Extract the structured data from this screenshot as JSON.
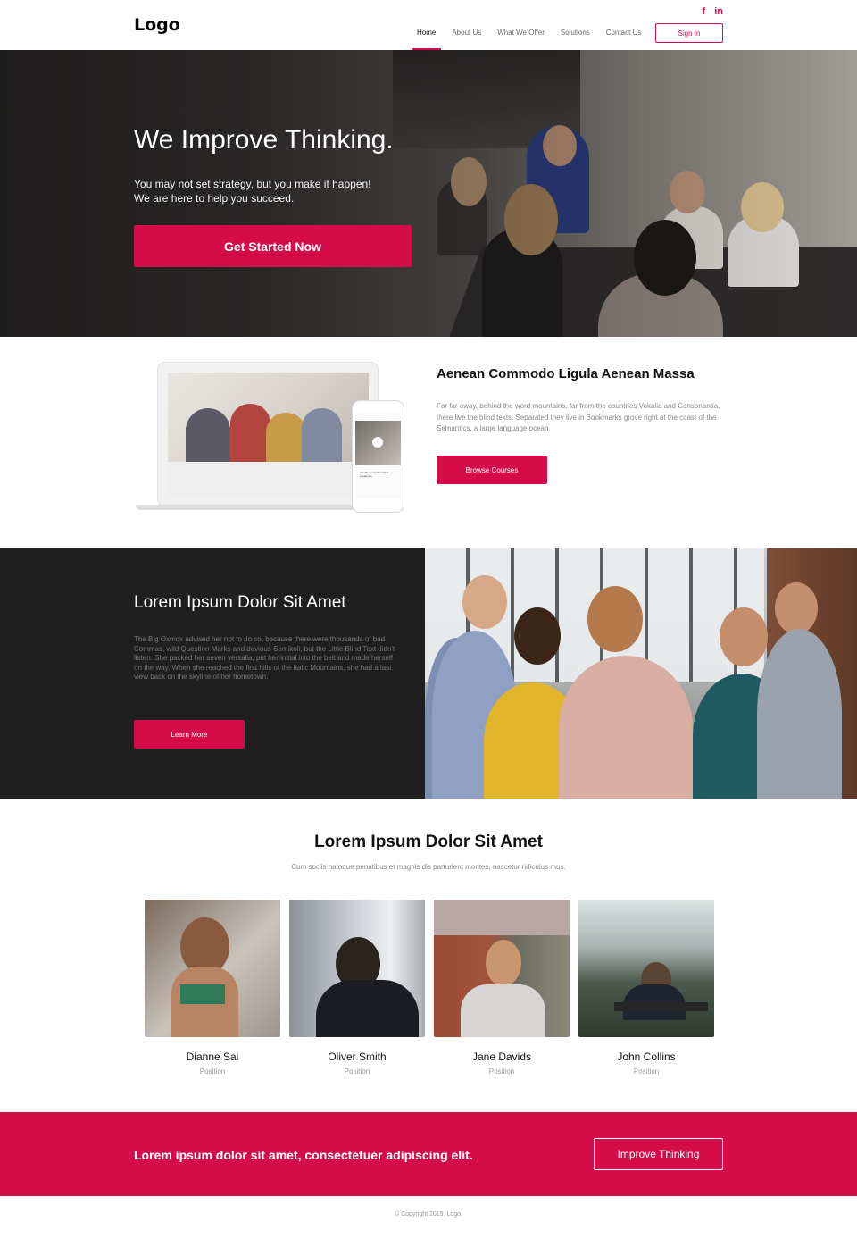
{
  "header": {
    "logo": "Logo",
    "social": {
      "facebook": "f",
      "linkedin": "in"
    },
    "nav": [
      "Home",
      "About Us",
      "What We Offer",
      "Solutions",
      "Contact Us"
    ],
    "active_nav": "Home",
    "signin": "Sign In"
  },
  "hero": {
    "title": "We Improve Thinking.",
    "subtitle_line1": "You may not set strategy, but you make it happen!",
    "subtitle_line2": "We are here to help you succeed.",
    "cta": "Get Started Now"
  },
  "about": {
    "title": "Aenean Commodo Ligula Aenean Massa",
    "text": "Far far away, behind the word mountains, far from the countries Vokalia and Consonantia, there live the blind texts. Separated they live in Bookmarks grove right at the coast of the Semantics, a large language ocean.",
    "button": "Browse Courses",
    "phone_caption": "Visualt mentosiba digital expelones"
  },
  "dark_section": {
    "title": "Lorem Ipsum Dolor Sit Amet",
    "text": "The Big Oxmox advised her not to do so, because there were thousands of bad Commas, wild Question Marks and devious Semikoli, but the Little Blind Text didn't listen. She packed her seven versalia, put her initial into the belt and made herself on the way. When she reached the first hills of the Italic Mountains, she had a last view back on the skyline of her hometown.",
    "button": "Learn More"
  },
  "team": {
    "title": "Lorem Ipsum Dolor Sit Amet",
    "subtitle": "Cum sociis natoque penatibus et magnis dis parturient montes, nascetur ridiculus mus.",
    "members": [
      {
        "name": "Dianne Sai",
        "position": "Position"
      },
      {
        "name": "Oliver Smith",
        "position": "Position"
      },
      {
        "name": "Jane Davids",
        "position": "Position"
      },
      {
        "name": "John Collins",
        "position": "Position"
      }
    ]
  },
  "band": {
    "text": "Lorem ipsum dolor sit amet, consectetuer adipiscing elit.",
    "button": "Improve Thinking"
  },
  "footer": {
    "copyright": "© Copyright 2019. Logo."
  },
  "colors": {
    "accent": "#d40d4a",
    "dark": "#1f1f20"
  }
}
